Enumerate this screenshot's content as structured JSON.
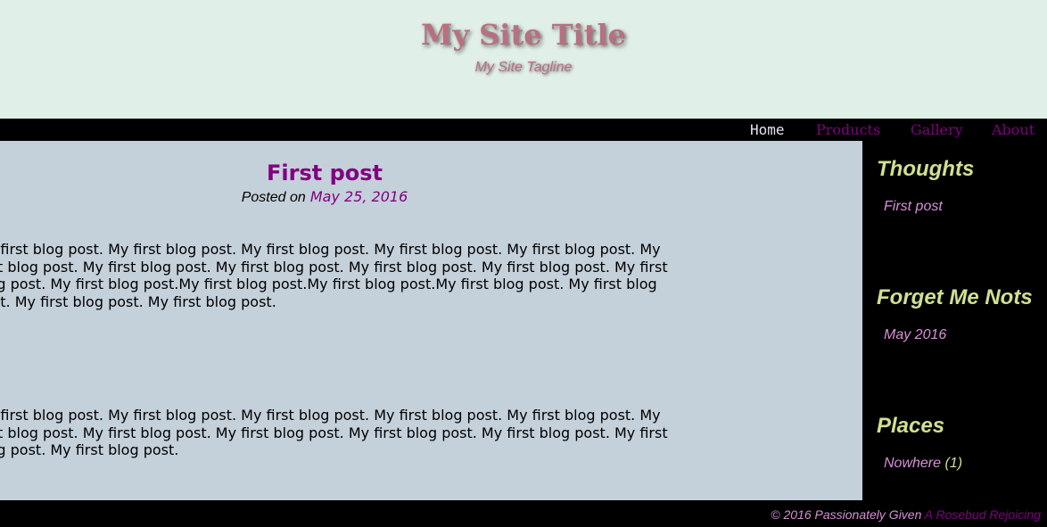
{
  "site": {
    "title": "My Site Title",
    "tagline": "My Site Tagline"
  },
  "nav": {
    "items": [
      {
        "label": "Home",
        "active": true
      },
      {
        "label": "Products",
        "active": false
      },
      {
        "label": "Gallery",
        "active": false
      },
      {
        "label": "About",
        "active": false
      }
    ]
  },
  "post": {
    "title": "First post",
    "posted_on_label": "Posted on",
    "date": "May 25, 2016",
    "paragraphs": [
      "My first blog post. My first blog post. My first blog post. My first blog post. My first blog post. My first blog post. My first blog post. My first blog post. My first blog post. My first blog post. My first blog post. My first blog post.My first blog post.My first blog post.My first blog post. My first blog post. My first blog post. My first blog post.",
      "My first blog post. My first blog post. My first blog post. My first blog post. My first blog post. My first blog post. My first blog post. My first blog post. My first blog post. My first blog post. My first blog post. My first blog post."
    ]
  },
  "sidebar": {
    "widgets": [
      {
        "title": "Thoughts",
        "link": "First post",
        "count": ""
      },
      {
        "title": "Forget Me Nots",
        "link": "May 2016",
        "count": ""
      },
      {
        "title": "Places",
        "link": "Nowhere",
        "count": "(1)"
      }
    ]
  },
  "footer": {
    "copyright": "© 2016 Passionately Given",
    "credit": "A Rosebud Rejoicing"
  },
  "colors": {
    "header_bg": "#e0efe8",
    "content_bg": "#c4d0da",
    "link": "#800080",
    "sidebar_title": "#d0e090",
    "sidebar_link": "#d890d8"
  }
}
